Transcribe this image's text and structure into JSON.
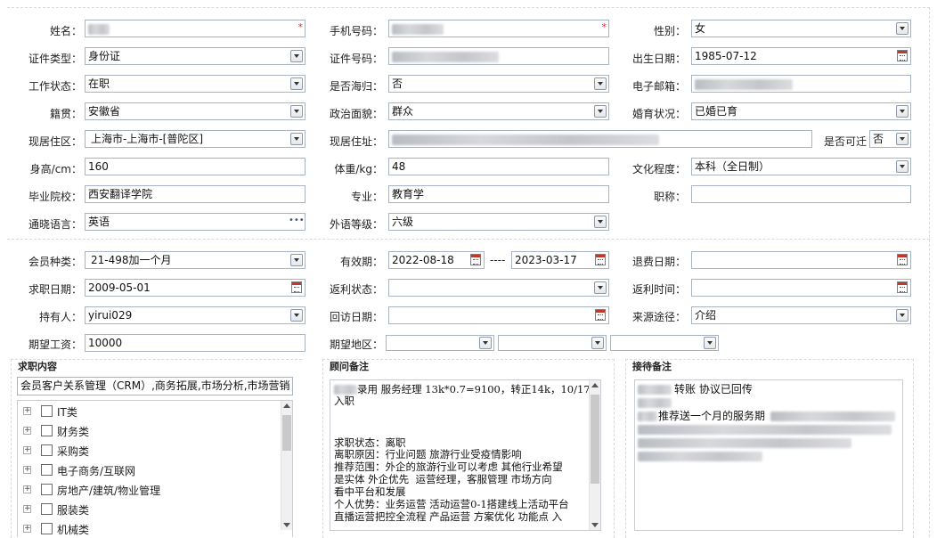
{
  "personal": {
    "name_label": "姓名：",
    "phone_label": "手机号码：",
    "gender_label": "性别：",
    "gender_value": "女",
    "id_type_label": "证件类型：",
    "id_type_value": "身份证",
    "id_no_label": "证件号码：",
    "birth_label": "出生日期：",
    "birth_value": "1985-07-12",
    "work_status_label": "工作状态：",
    "work_status_value": "在职",
    "overseas_label": "是否海归：",
    "overseas_value": "否",
    "email_label": "电子邮箱：",
    "native_label": "籍贯：",
    "native_value": "安徽省",
    "political_label": "政治面貌：",
    "political_value": "群众",
    "marital_label": "婚育状况：",
    "marital_value": "已婚已育",
    "residence_label": "现居住区：",
    "residence_value": "上海市-上海市-[普陀区]",
    "address_label": "现居住址：",
    "movable_label": "是否可迁",
    "movable_value": "否",
    "height_label": "身高/cm：",
    "height_value": "160",
    "weight_label": "体重/kg：",
    "weight_value": "48",
    "education_label": "文化程度：",
    "education_value": "本科（全日制）",
    "school_label": "毕业院校：",
    "school_value": "西安翻译学院",
    "major_label": "专业：",
    "major_value": "教育学",
    "title_label": "职称：",
    "language_label": "通晓语言：",
    "language_value": "英语",
    "lang_level_label": "外语等级：",
    "lang_level_value": "六级"
  },
  "membership": {
    "type_label": "会员种类：",
    "type_value": "21-498加一个月",
    "valid_label": "有效期：",
    "valid_from": "2022-08-18",
    "valid_sep": "----",
    "valid_to": "2023-03-17",
    "refund_date_label": "退费日期：",
    "job_date_label": "求职日期：",
    "job_date_value": "2009-05-01",
    "rebate_status_label": "返利状态：",
    "rebate_time_label": "返利时间：",
    "holder_label": "持有人：",
    "holder_value": "yirui029",
    "visit_date_label": "回访日期：",
    "source_label": "来源途径：",
    "source_value": "介绍",
    "salary_label": "期望工资：",
    "salary_value": "10000",
    "region_label": "期望地区："
  },
  "job_content": {
    "title": "求职内容",
    "summary": "会员客户关系管理（CRM）,商务拓展,市场分析,市场营销",
    "items": [
      {
        "label": "IT类"
      },
      {
        "label": "财务类"
      },
      {
        "label": "采购类"
      },
      {
        "label": "电子商务/互联网"
      },
      {
        "label": "房地产/建筑/物业管理"
      },
      {
        "label": "服装类"
      },
      {
        "label": "机械类"
      }
    ]
  },
  "consultant_note": {
    "title": "顾问备注",
    "line1": "录用 服务经理 13k*0.7=9100，转正14k，10/17",
    "line2": "入职",
    "line3": "",
    "line4": "求职状态：离职",
    "line5": "离职原因：行业问题 旅游行业受疫情影响",
    "line6": "推荐范围：外企的旅游行业可以考虑 其他行业希望",
    "line7": "是实体 外企优先  运营经理，客服管理 市场方向",
    "line8": "看中平台和发展",
    "line9": "个人优势：业务运营 活动运营0-1搭建线上活动平台",
    "line10": "直播运营把控全流程 产品运营 方案优化 功能点 入"
  },
  "reception_note": {
    "title": "接待备注",
    "line1": "转账 协议已回传",
    "line2": "推荐送一个月的服务期"
  }
}
